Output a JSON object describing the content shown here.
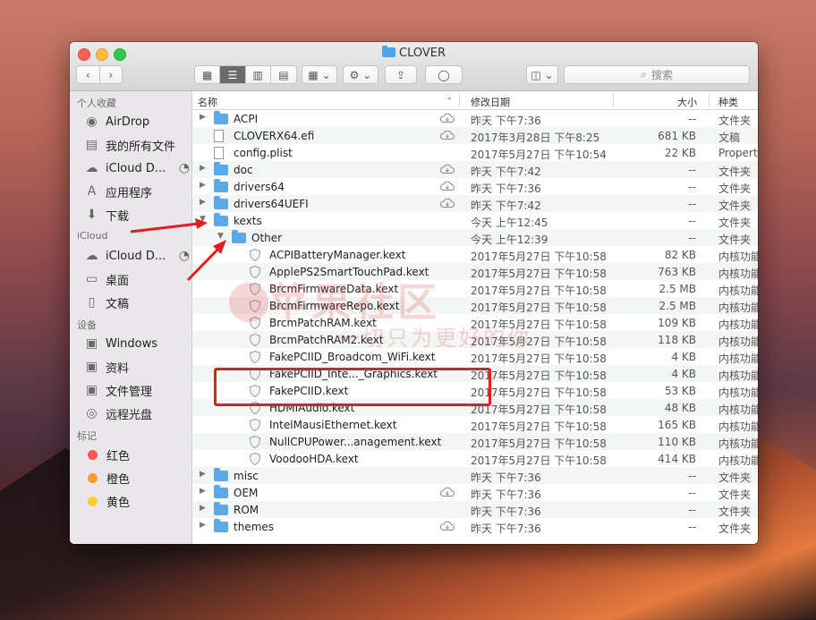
{
  "window": {
    "title": "CLOVER"
  },
  "toolbar": {
    "back_icon": "chevron-left-icon",
    "forward_icon": "chevron-right-icon",
    "search_placeholder": "搜索"
  },
  "sidebar": {
    "favorites_header": "个人收藏",
    "favorites": [
      {
        "label": "AirDrop",
        "icon": "airdrop-icon"
      },
      {
        "label": "我的所有文件",
        "icon": "all-files-icon"
      },
      {
        "label": "iCloud D...",
        "icon": "cloud-icon"
      },
      {
        "label": "应用程序",
        "icon": "applications-icon"
      },
      {
        "label": "下载",
        "icon": "download-icon"
      }
    ],
    "icloud_header": "iCloud",
    "icloud": [
      {
        "label": "iCloud D...",
        "icon": "cloud-icon"
      },
      {
        "label": "桌面",
        "icon": "desktop-icon"
      },
      {
        "label": "文稿",
        "icon": "documents-icon"
      }
    ],
    "devices_header": "设备",
    "devices": [
      {
        "label": "Windows",
        "icon": "disk-icon"
      },
      {
        "label": "资料",
        "icon": "disk-icon"
      },
      {
        "label": "文件管理",
        "icon": "disk-icon"
      },
      {
        "label": "远程光盘",
        "icon": "optical-disc-icon"
      }
    ],
    "tags_header": "标记",
    "tags": [
      {
        "label": "红色",
        "color": "#fc5753"
      },
      {
        "label": "橙色",
        "color": "#fd9a2d"
      },
      {
        "label": "黄色",
        "color": "#fdcc2f"
      }
    ]
  },
  "columns": {
    "name": "名称",
    "date": "修改日期",
    "size": "大小",
    "kind": "种类"
  },
  "files": [
    {
      "name": "ACPI",
      "date": "昨天 下午7:36",
      "size": "--",
      "kind": "文件夹",
      "type": "folder",
      "level": 0,
      "disclosure": "closed",
      "cloud": true
    },
    {
      "name": "CLOVERX64.efi",
      "date": "2017年3月28日 下午8:25",
      "size": "681 KB",
      "kind": "文稿",
      "type": "doc",
      "level": 0,
      "disclosure": "",
      "cloud": true
    },
    {
      "name": "config.plist",
      "date": "2017年5月27日 下午10:54",
      "size": "22 KB",
      "kind": "Property",
      "type": "doc",
      "level": 0,
      "disclosure": "",
      "cloud": false
    },
    {
      "name": "doc",
      "date": "昨天 下午7:42",
      "size": "--",
      "kind": "文件夹",
      "type": "folder",
      "level": 0,
      "disclosure": "closed",
      "cloud": true
    },
    {
      "name": "drivers64",
      "date": "昨天 下午7:36",
      "size": "--",
      "kind": "文件夹",
      "type": "folder",
      "level": 0,
      "disclosure": "closed",
      "cloud": true
    },
    {
      "name": "drivers64UEFI",
      "date": "昨天 下午7:42",
      "size": "--",
      "kind": "文件夹",
      "type": "folder",
      "level": 0,
      "disclosure": "closed",
      "cloud": true
    },
    {
      "name": "kexts",
      "date": "今天 上午12:45",
      "size": "--",
      "kind": "文件夹",
      "type": "folder",
      "level": 0,
      "disclosure": "open",
      "cloud": false
    },
    {
      "name": "Other",
      "date": "今天 上午12:39",
      "size": "--",
      "kind": "文件夹",
      "type": "folder",
      "level": 1,
      "disclosure": "open",
      "cloud": false
    },
    {
      "name": "ACPIBatteryManager.kext",
      "date": "2017年5月27日 下午10:58",
      "size": "82 KB",
      "kind": "内核功能",
      "type": "kext",
      "level": 2,
      "disclosure": "",
      "cloud": false
    },
    {
      "name": "ApplePS2SmartTouchPad.kext",
      "date": "2017年5月27日 下午10:58",
      "size": "763 KB",
      "kind": "内核功能",
      "type": "kext",
      "level": 2,
      "disclosure": "",
      "cloud": false
    },
    {
      "name": "BrcmFirmwareData.kext",
      "date": "2017年5月27日 下午10:58",
      "size": "2.5 MB",
      "kind": "内核功能",
      "type": "kext",
      "level": 2,
      "disclosure": "",
      "cloud": false
    },
    {
      "name": "BrcmFirmwareRepo.kext",
      "date": "2017年5月27日 下午10:58",
      "size": "2.5 MB",
      "kind": "内核功能",
      "type": "kext",
      "level": 2,
      "disclosure": "",
      "cloud": false
    },
    {
      "name": "BrcmPatchRAM.kext",
      "date": "2017年5月27日 下午10:58",
      "size": "109 KB",
      "kind": "内核功能",
      "type": "kext",
      "level": 2,
      "disclosure": "",
      "cloud": false
    },
    {
      "name": "BrcmPatchRAM2.kext",
      "date": "2017年5月27日 下午10:58",
      "size": "118 KB",
      "kind": "内核功能",
      "type": "kext",
      "level": 2,
      "disclosure": "",
      "cloud": false
    },
    {
      "name": "FakePCIID_Broadcom_WiFi.kext",
      "date": "2017年5月27日 下午10:58",
      "size": "4 KB",
      "kind": "内核功能",
      "type": "kext",
      "level": 2,
      "disclosure": "",
      "cloud": false
    },
    {
      "name": "FakePCIID_Inte..._Graphics.kext",
      "date": "2017年5月27日 下午10:58",
      "size": "4 KB",
      "kind": "内核功能",
      "type": "kext",
      "level": 2,
      "disclosure": "",
      "cloud": false
    },
    {
      "name": "FakePCIID.kext",
      "date": "2017年5月27日 下午10:58",
      "size": "53 KB",
      "kind": "内核功能",
      "type": "kext",
      "level": 2,
      "disclosure": "",
      "cloud": false
    },
    {
      "name": "HDMIAudio.kext",
      "date": "2017年5月27日 下午10:58",
      "size": "48 KB",
      "kind": "内核功能",
      "type": "kext",
      "level": 2,
      "disclosure": "",
      "cloud": false
    },
    {
      "name": "IntelMausiEthernet.kext",
      "date": "2017年5月27日 下午10:58",
      "size": "165 KB",
      "kind": "内核功能",
      "type": "kext",
      "level": 2,
      "disclosure": "",
      "cloud": false
    },
    {
      "name": "NullCPUPower...anagement.kext",
      "date": "2017年5月27日 下午10:58",
      "size": "110 KB",
      "kind": "内核功能",
      "type": "kext",
      "level": 2,
      "disclosure": "",
      "cloud": false
    },
    {
      "name": "VoodooHDA.kext",
      "date": "2017年5月27日 下午10:58",
      "size": "414 KB",
      "kind": "内核功能",
      "type": "kext",
      "level": 2,
      "disclosure": "",
      "cloud": false
    },
    {
      "name": "misc",
      "date": "昨天 下午7:36",
      "size": "--",
      "kind": "文件夹",
      "type": "folder",
      "level": 0,
      "disclosure": "closed",
      "cloud": false
    },
    {
      "name": "OEM",
      "date": "昨天 下午7:36",
      "size": "--",
      "kind": "文件夹",
      "type": "folder",
      "level": 0,
      "disclosure": "closed",
      "cloud": true
    },
    {
      "name": "ROM",
      "date": "昨天 下午7:36",
      "size": "--",
      "kind": "文件夹",
      "type": "folder",
      "level": 0,
      "disclosure": "closed",
      "cloud": false
    },
    {
      "name": "themes",
      "date": "昨天 下午7:36",
      "size": "--",
      "kind": "文件夹",
      "type": "folder",
      "level": 0,
      "disclosure": "closed",
      "cloud": true
    }
  ],
  "watermark": {
    "main": "苹果社区",
    "sub": "一切只为更好的你"
  },
  "colors": {
    "annotation_red": "#e31e1e",
    "folder_blue": "#5aa9e8"
  }
}
